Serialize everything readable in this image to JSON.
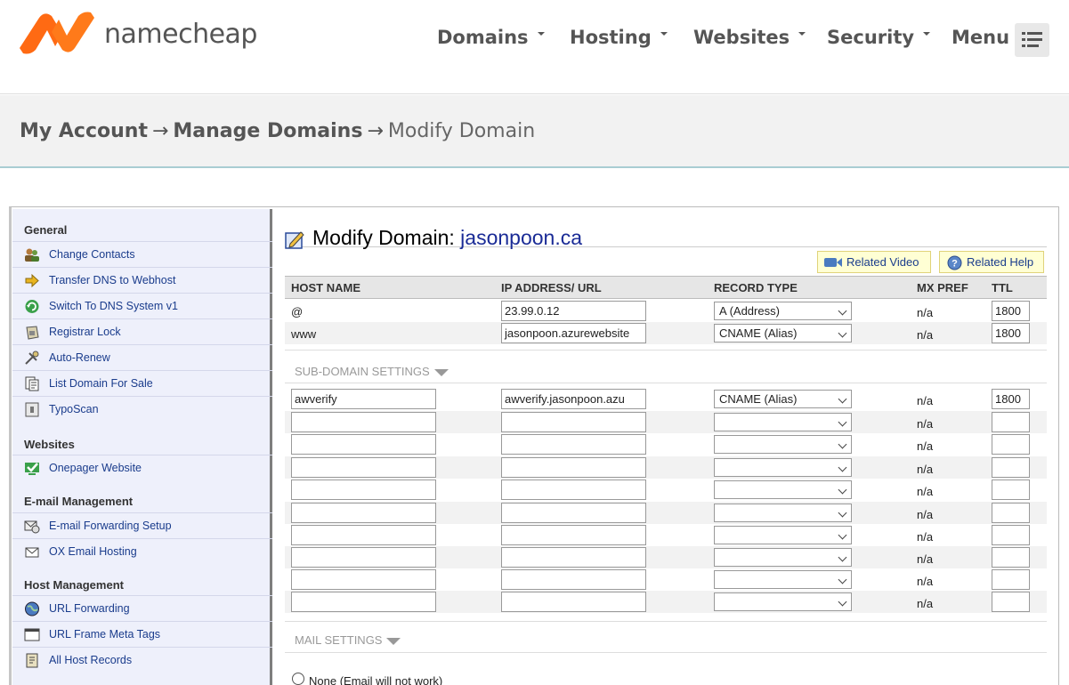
{
  "brand": {
    "name": "namecheap",
    "accent": "#ff6a13",
    "accent_dark": "#e04e11"
  },
  "nav": {
    "items": [
      "Domains",
      "Hosting",
      "Websites",
      "Security",
      "Menu"
    ],
    "menu_icon": "hamburger-menu-icon"
  },
  "breadcrumb": {
    "items": [
      "My Account",
      "Manage Domains"
    ],
    "separator": "→",
    "current": "Modify Domain"
  },
  "sidebar": {
    "sections": [
      {
        "heading": "General",
        "items": [
          {
            "label": "Change Contacts",
            "icon": "contacts-icon"
          },
          {
            "label": "Transfer DNS to Webhost",
            "icon": "arrow-right-icon"
          },
          {
            "label": "Switch To DNS System v1",
            "icon": "refresh-icon"
          },
          {
            "label": "Registrar Lock",
            "icon": "lock-icon"
          },
          {
            "label": "Auto-Renew",
            "icon": "auto-renew-icon"
          },
          {
            "label": "List Domain For Sale",
            "icon": "document-icon"
          },
          {
            "label": "TypoScan",
            "icon": "typoscan-icon"
          }
        ]
      },
      {
        "heading": "Websites",
        "items": [
          {
            "label": "Onepager Website",
            "icon": "checkmark-monitor-icon"
          }
        ]
      },
      {
        "heading": "E-mail Management",
        "items": [
          {
            "label": "E-mail Forwarding Setup",
            "icon": "email-forward-icon"
          },
          {
            "label": "OX Email Hosting",
            "icon": "envelope-icon"
          }
        ]
      },
      {
        "heading": "Host Management",
        "items": [
          {
            "label": "URL Forwarding",
            "icon": "globe-icon"
          },
          {
            "label": "URL Frame Meta Tags",
            "icon": "window-icon"
          },
          {
            "label": "All Host Records",
            "icon": "records-icon"
          }
        ]
      }
    ]
  },
  "content": {
    "title_prefix": "Modify Domain:",
    "domain": "jasonpoon.ca",
    "related_video": "Related Video",
    "related_help": "Related Help",
    "columns": [
      "HOST NAME",
      "IP ADDRESS/ URL",
      "RECORD TYPE",
      "MX PREF",
      "TTL"
    ],
    "host_records": [
      {
        "host": "@",
        "address": "23.99.0.12",
        "type": "A (Address)",
        "mx": "n/a",
        "ttl": "1800"
      },
      {
        "host": "www",
        "address": "jasonpoon.azurewebsite",
        "type": "CNAME (Alias)",
        "mx": "n/a",
        "ttl": "1800"
      }
    ],
    "subdomain_label": "SUB-DOMAIN SETTINGS",
    "subdomains": [
      {
        "host": "awverify",
        "address": "awverify.jasonpoon.azu",
        "type": "CNAME (Alias)",
        "mx": "n/a",
        "ttl": "1800"
      },
      {
        "host": "",
        "address": "",
        "type": "",
        "mx": "n/a",
        "ttl": ""
      },
      {
        "host": "",
        "address": "",
        "type": "",
        "mx": "n/a",
        "ttl": ""
      },
      {
        "host": "",
        "address": "",
        "type": "",
        "mx": "n/a",
        "ttl": ""
      },
      {
        "host": "",
        "address": "",
        "type": "",
        "mx": "n/a",
        "ttl": ""
      },
      {
        "host": "",
        "address": "",
        "type": "",
        "mx": "n/a",
        "ttl": ""
      },
      {
        "host": "",
        "address": "",
        "type": "",
        "mx": "n/a",
        "ttl": ""
      },
      {
        "host": "",
        "address": "",
        "type": "",
        "mx": "n/a",
        "ttl": ""
      },
      {
        "host": "",
        "address": "",
        "type": "",
        "mx": "n/a",
        "ttl": ""
      },
      {
        "host": "",
        "address": "",
        "type": "",
        "mx": "n/a",
        "ttl": ""
      }
    ],
    "mail_label": "MAIL SETTINGS",
    "mail_option_none": "None (Email will not work)"
  }
}
